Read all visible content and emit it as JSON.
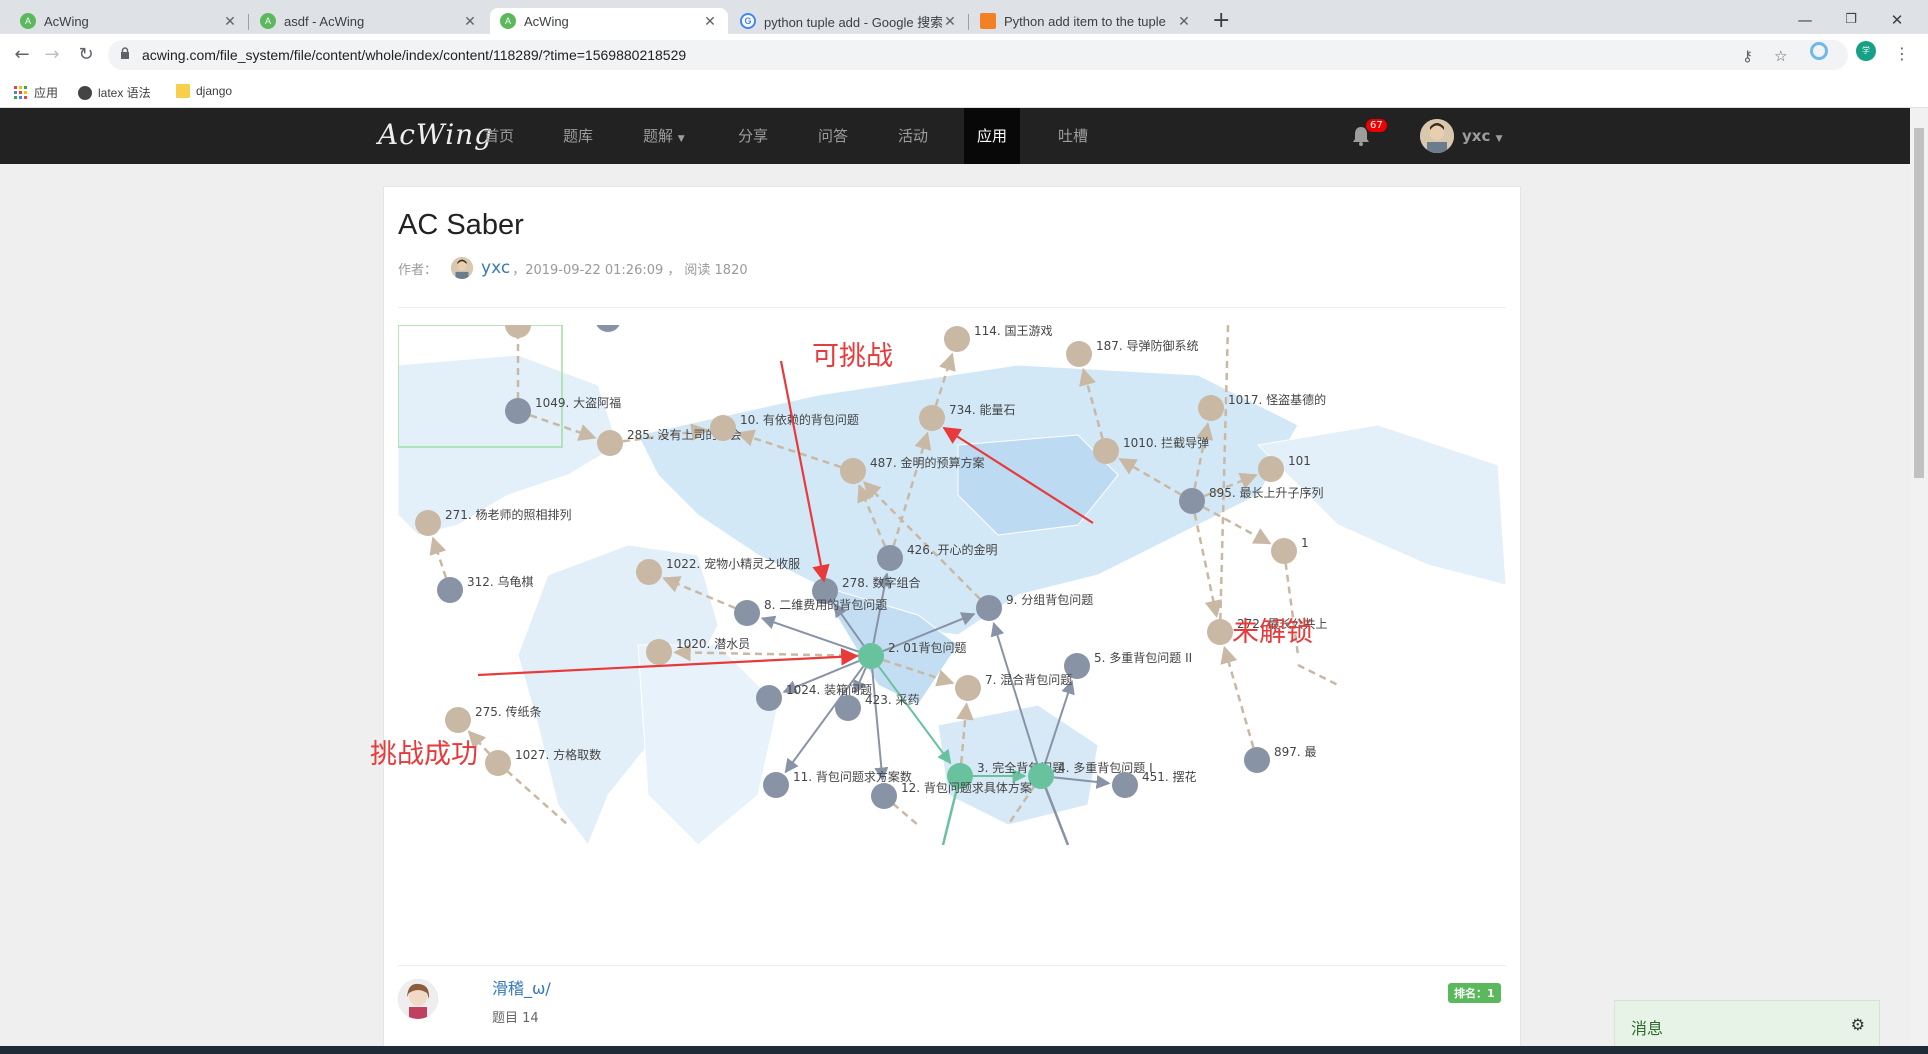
{
  "browser": {
    "tabs": [
      {
        "title": "AcWing",
        "favicon": "acwing-icon",
        "active": false
      },
      {
        "title": "asdf - AcWing",
        "favicon": "acwing-icon",
        "active": false
      },
      {
        "title": "AcWing",
        "favicon": "acwing-icon",
        "active": true
      },
      {
        "title": "python tuple add - Google 搜索",
        "favicon": "google-icon",
        "active": false
      },
      {
        "title": "Python add item to the tuple",
        "favicon": "stackoverflow-icon",
        "active": false
      }
    ],
    "url": "acwing.com/file_system/file/content/whole/index/content/118289/?time=1569880218529",
    "bookmarks": [
      "应用",
      "latex 语法",
      "django"
    ]
  },
  "site": {
    "logo": "AcWing",
    "nav": [
      "首页",
      "题库",
      "题解",
      "分享",
      "问答",
      "活动",
      "应用",
      "吐槽"
    ],
    "active_nav": "应用",
    "notification_count": "67",
    "username": "yxc"
  },
  "article": {
    "title": "AC Saber",
    "author_label": "作者：",
    "author": "yxc",
    "date": "，2019-09-22 01:26:09 ，",
    "reads": "阅读 1820"
  },
  "graph": {
    "colors": {
      "success": "#67c29d",
      "available": "#c9b8a3",
      "locked": "#8893a6",
      "arrow_dashed": "#c9b8a3",
      "arrow_solid": "#8893a6",
      "arrow_green": "#67c29d"
    },
    "nodes": [
      {
        "id": "n1049",
        "label": "1049. 大盗阿福",
        "status": "locked"
      },
      {
        "id": "n285",
        "label": "285. 没有上司的舞会",
        "status": "available"
      },
      {
        "id": "n10",
        "label": "10. 有依赖的背包问题",
        "status": "available"
      },
      {
        "id": "n487",
        "label": "487. 金明的预算方案",
        "status": "available"
      },
      {
        "id": "n114",
        "label": "114. 国王游戏",
        "status": "available"
      },
      {
        "id": "n734",
        "label": "734. 能量石",
        "status": "available"
      },
      {
        "id": "n187",
        "label": "187. 导弹防御系统",
        "status": "available"
      },
      {
        "id": "n1010",
        "label": "1010. 拦截导弹",
        "status": "available"
      },
      {
        "id": "n1017",
        "label": "1017. 怪盗基德的",
        "status": "available"
      },
      {
        "id": "n895",
        "label": "895. 最长上升子序列",
        "status": "locked"
      },
      {
        "id": "n101x",
        "label": "101",
        "status": "available"
      },
      {
        "id": "n1xx",
        "label": "1",
        "status": "available"
      },
      {
        "id": "n271",
        "label": "271. 杨老师的照相排列",
        "status": "available"
      },
      {
        "id": "n312",
        "label": "312. 乌龟棋",
        "status": "locked"
      },
      {
        "id": "n1022",
        "label": "1022. 宠物小精灵之收服",
        "status": "available"
      },
      {
        "id": "n426",
        "label": "426. 开心的金明",
        "status": "locked"
      },
      {
        "id": "n278",
        "label": "278. 数字组合",
        "status": "locked"
      },
      {
        "id": "n8",
        "label": "8. 二维费用的背包问题",
        "status": "locked"
      },
      {
        "id": "n9",
        "label": "9. 分组背包问题",
        "status": "locked"
      },
      {
        "id": "n1020",
        "label": "1020. 潜水员",
        "status": "available"
      },
      {
        "id": "n2",
        "label": "2. 01背包问题",
        "status": "success"
      },
      {
        "id": "n272",
        "label": "272. 最长公共上",
        "status": "available"
      },
      {
        "id": "n5",
        "label": "5. 多重背包问题 II",
        "status": "locked"
      },
      {
        "id": "n7",
        "label": "7. 混合背包问题",
        "status": "available"
      },
      {
        "id": "n1024",
        "label": "1024. 装箱问题",
        "status": "locked"
      },
      {
        "id": "n423",
        "label": "423. 采药",
        "status": "locked"
      },
      {
        "id": "n275",
        "label": "275. 传纸条",
        "status": "available"
      },
      {
        "id": "n1027",
        "label": "1027. 方格取数",
        "status": "available"
      },
      {
        "id": "n3",
        "label": "3. 完全背包问题",
        "status": "success"
      },
      {
        "id": "n4",
        "label": "4. 多重背包问题 I",
        "status": "success"
      },
      {
        "id": "n451",
        "label": "451. 摆花",
        "status": "locked"
      },
      {
        "id": "n897",
        "label": "897. 最",
        "status": "locked"
      },
      {
        "id": "n11",
        "label": "11. 背包问题求方案数",
        "status": "locked"
      },
      {
        "id": "n12",
        "label": "12. 背包问题求具体方案",
        "status": "locked"
      }
    ]
  },
  "annotations": {
    "challengeable": "可挑战",
    "locked": "未解锁",
    "success": "挑战成功"
  },
  "ranking": {
    "name": "滑稽_ω/",
    "count": "题目 14",
    "rank": "排名：1"
  },
  "message_box": {
    "title": "消息"
  }
}
